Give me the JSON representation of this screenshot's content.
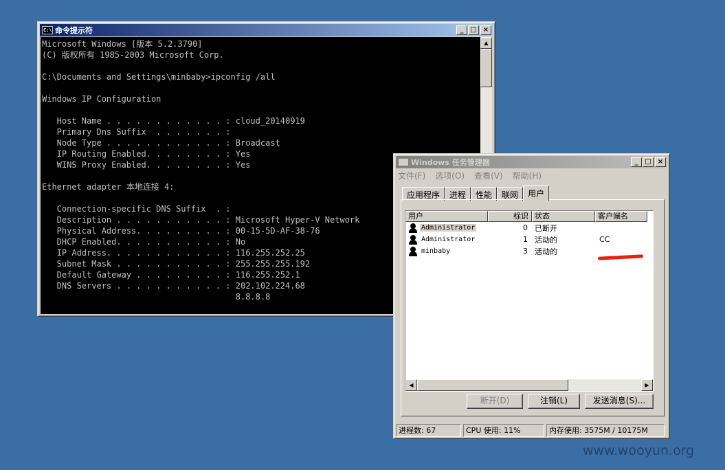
{
  "cmd": {
    "title": "命令提示符",
    "icon": "C:\\",
    "lines": [
      "Microsoft Windows [版本 5.2.3790]",
      "(C) 版权所有 1985-2003 Microsoft Corp.",
      "",
      "C:\\Documents and Settings\\minbaby>ipconfig /all",
      "",
      "Windows IP Configuration",
      "",
      "   Host Name . . . . . . . . . . . . : cloud_20140919",
      "   Primary Dns Suffix  . . . . . . . :",
      "   Node Type . . . . . . . . . . . . : Broadcast",
      "   IP Routing Enabled. . . . . . . . : Yes",
      "   WINS Proxy Enabled. . . . . . . . : Yes",
      "",
      "Ethernet adapter 本地连接 4:",
      "",
      "   Connection-specific DNS Suffix  . :",
      "   Description . . . . . . . . . . . : Microsoft Hyper-V Network",
      "   Physical Address. . . . . . . . . : 00-15-5D-AF-38-76",
      "   DHCP Enabled. . . . . . . . . . . : No",
      "   IP Address. . . . . . . . . . . . : 116.255.252.25",
      "   Subnet Mask . . . . . . . . . . . : 255.255.255.192",
      "   Default Gateway . . . . . . . . . : 116.255.252.1",
      "   DNS Servers . . . . . . . . . . . : 202.102.224.68",
      "                                       8.8.8.8"
    ]
  },
  "taskmgr": {
    "title": "Windows 任务管理器",
    "menu": [
      "文件(F)",
      "选项(O)",
      "查看(V)",
      "帮助(H)"
    ],
    "tabs": [
      "应用程序",
      "进程",
      "性能",
      "联网",
      "用户"
    ],
    "active_tab": "用户",
    "columns": [
      "用户",
      "标识",
      "状态",
      "客户端名"
    ],
    "rows": [
      {
        "user": "Administrator",
        "id": "0",
        "status": "已断开",
        "client": ""
      },
      {
        "user": "Administrator",
        "id": "1",
        "status": "活动的",
        "client": "CC"
      },
      {
        "user": "minbaby",
        "id": "3",
        "status": "活动的",
        "client": ""
      }
    ],
    "buttons": {
      "disconnect": "断开(D)",
      "logoff": "注销(L)",
      "send_message": "发送消息(S)..."
    },
    "status": {
      "processes": "进程数: 67",
      "cpu": "CPU 使用: 11%",
      "memory": "内存使用: 3575M / 10175M"
    }
  },
  "watermark": "www.wooyun.org",
  "colors": {
    "desktop": "#3a6ea5",
    "titlebar": "#0a246a",
    "console_bg": "#000000",
    "console_fg": "#c0c0c0",
    "redaction": "#e8200c"
  }
}
